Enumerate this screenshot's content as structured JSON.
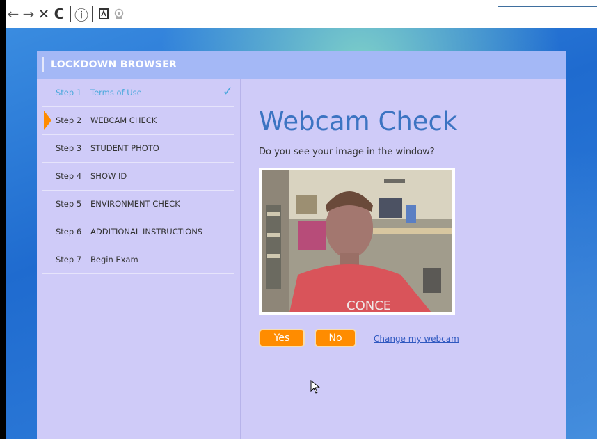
{
  "browser": {
    "back_icon": "←",
    "forward_icon": "→",
    "stop_icon": "✕",
    "reload_icon": "C",
    "info_icon": "ⓘ"
  },
  "window": {
    "title": "LOCKDOWN BROWSER"
  },
  "steps": [
    {
      "number": "Step 1",
      "label": "Terms of Use",
      "status": "done"
    },
    {
      "number": "Step 2",
      "label": "WEBCAM CHECK",
      "status": "current"
    },
    {
      "number": "Step 3",
      "label": "STUDENT PHOTO",
      "status": "pending"
    },
    {
      "number": "Step 4",
      "label": "SHOW ID",
      "status": "pending"
    },
    {
      "number": "Step 5",
      "label": "ENVIRONMENT CHECK",
      "status": "pending"
    },
    {
      "number": "Step 6",
      "label": "ADDITIONAL INSTRUCTIONS",
      "status": "pending"
    },
    {
      "number": "Step 7",
      "label": "Begin Exam",
      "status": "pending"
    }
  ],
  "main": {
    "heading": "Webcam Check",
    "question": "Do you see your image in the window?",
    "shirt_text": "CONCE",
    "yes_label": "Yes",
    "no_label": "No",
    "change_webcam_label": "Change my webcam"
  },
  "colors": {
    "accent": "#ff8c00",
    "header": "#a4b8f6",
    "panel": "#cfcbf8",
    "heading": "#3c74c2",
    "link": "#2f58c0"
  }
}
